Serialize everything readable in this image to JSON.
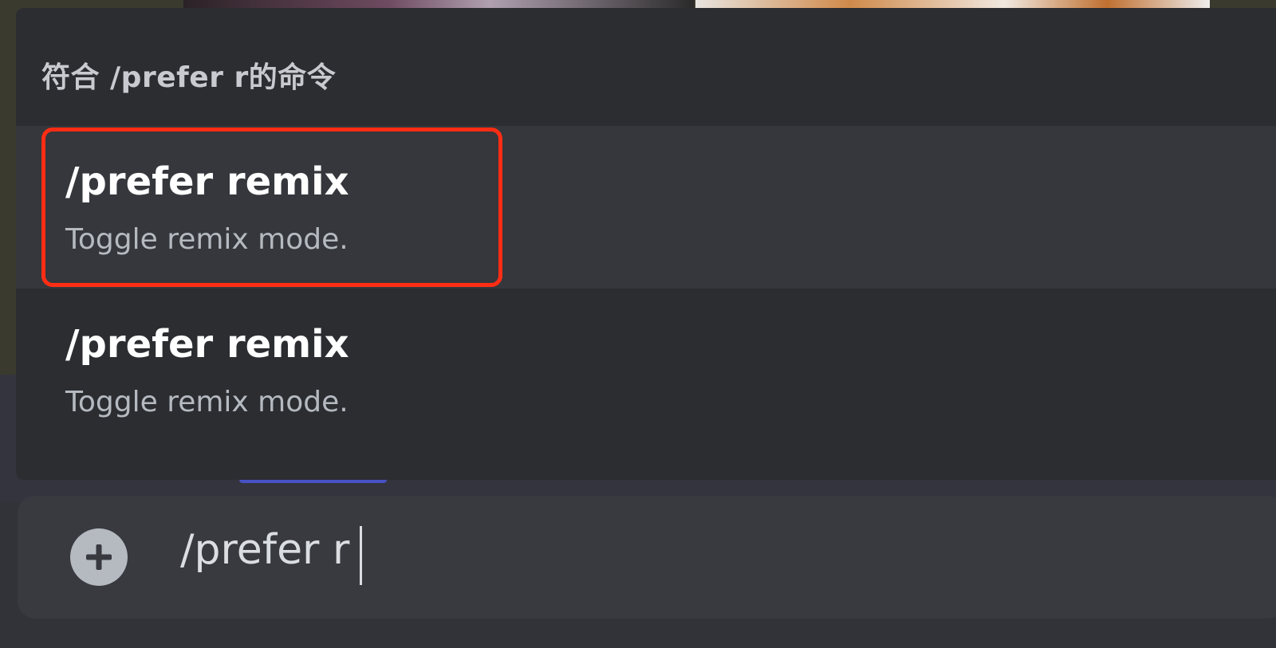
{
  "autocomplete": {
    "header": "符合 /prefer r的命令",
    "items": [
      {
        "command": "/prefer remix",
        "description": "Toggle remix mode.",
        "selected": true
      },
      {
        "command": "/prefer remix",
        "description": "Toggle remix mode.",
        "selected": false
      }
    ]
  },
  "composer": {
    "value": "/prefer r",
    "add_icon": "plus-circle-icon"
  },
  "colors": {
    "popup_bg": "#2b2d31",
    "selected_bg": "#35373c",
    "highlight_border": "#ff2d14",
    "input_bg": "#383a40"
  }
}
